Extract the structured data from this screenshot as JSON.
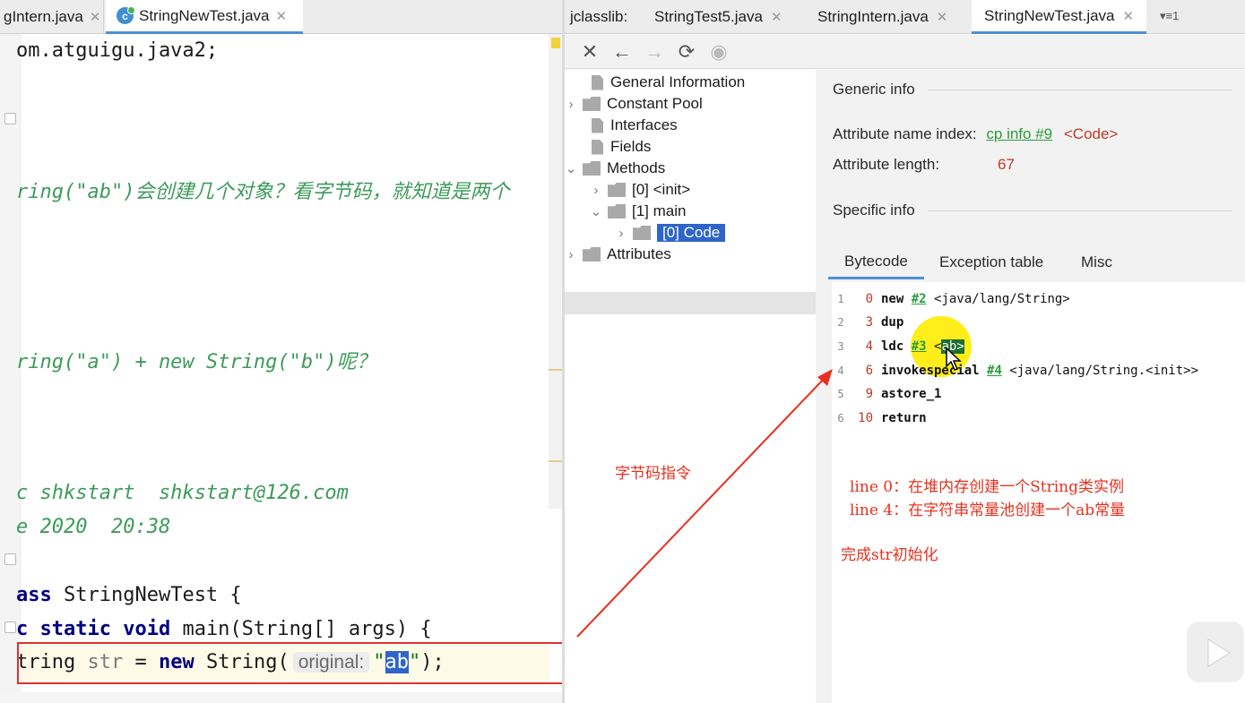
{
  "left_tabs": [
    {
      "label": "gIntern.java"
    },
    {
      "label": "StringNewTest.java"
    }
  ],
  "close_glyph": "✕",
  "code_lines": {
    "l1": "om.atguigu.java2;",
    "l2": "ring(\"ab\")会创建几个对象？看字节码，就知道是两个",
    "l3": "ring(\"a\") + new String(\"b\")呢？",
    "l4": "c shkstart  shkstart@126.com",
    "l5": "e 2020  20:38",
    "l6_kw": "ass",
    "l6_rest": " StringNewTest {",
    "l7_a": "c ",
    "l7_kw1": "static void",
    "l7_rest": " main(String[] args) {",
    "l8_a": "tring ",
    "l8_var": "str",
    "l8_eq": " = ",
    "l8_kw": "new",
    "l8_b": " String(",
    "l8_hint": "original:",
    "l8_q1": "\"",
    "l8_sel": "ab",
    "l8_q2": "\"",
    "l8_end": ");"
  },
  "right_tabs": {
    "prefix": "jclasslib:",
    "items": [
      {
        "label": "StringTest5.java"
      },
      {
        "label": "StringIntern.java"
      },
      {
        "label": "StringNewTest.java"
      }
    ],
    "overflow": "▾≡1"
  },
  "toolbar": {
    "close": "✕",
    "back": "←",
    "forward": "→",
    "refresh": "⟳",
    "web": "◉"
  },
  "tree": {
    "general": "General Information",
    "constant_pool": "Constant Pool",
    "interfaces": "Interfaces",
    "fields": "Fields",
    "methods": "Methods",
    "init": "[0] <init>",
    "main": "[1] main",
    "code": "[0] Code",
    "attributes": "Attributes"
  },
  "detail": {
    "generic_info": "Generic info",
    "attr_name_label": "Attribute name index:",
    "attr_name_link": "cp info #9",
    "attr_name_value": "<Code>",
    "attr_len_label": "Attribute length:",
    "attr_len_value": "67",
    "specific_info": "Specific info",
    "tabs": [
      "Bytecode",
      "Exception table",
      "Misc"
    ]
  },
  "bytecode": [
    {
      "line": "1",
      "offset": "0",
      "op": "new",
      "ref": "#2",
      "arg": " <java/lang/String>"
    },
    {
      "line": "2",
      "offset": "3",
      "op": "dup",
      "ref": "",
      "arg": ""
    },
    {
      "line": "3",
      "offset": "4",
      "op": "ldc",
      "ref": "#3",
      "arg": " <",
      "hl": "ab",
      "tail": ">"
    },
    {
      "line": "4",
      "offset": "6",
      "op": "invokespecial",
      "ref": "#4",
      "arg": " <java/lang/String.<init>>"
    },
    {
      "line": "5",
      "offset": "9",
      "op": "astore_1",
      "ref": "",
      "arg": ""
    },
    {
      "line": "6",
      "offset": "10",
      "op": "return",
      "ref": "",
      "arg": ""
    }
  ],
  "annotations": {
    "bytecode_label": "字节码指令",
    "line0": "line 0：在堆内存创建一个String类实例",
    "line4": "line 4：在字符串常量池创建一个ab常量",
    "done": "完成str初始化"
  },
  "colors": {
    "accent": "#4d8fd6",
    "selection": "#2f65ca",
    "annotation": "#e8301e",
    "link": "#2a9d3a"
  }
}
